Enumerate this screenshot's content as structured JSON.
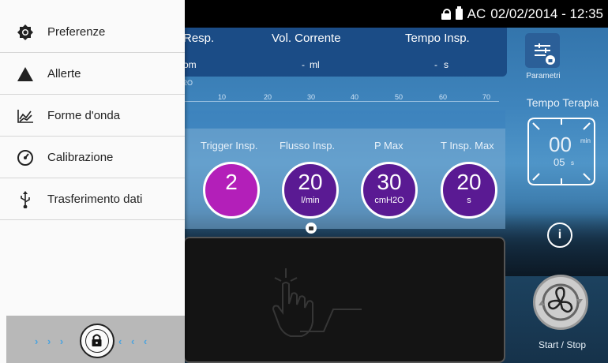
{
  "status_bar": {
    "mode": "AC",
    "datetime": "02/02/2014 - 12:35"
  },
  "measurements": {
    "headers": [
      "Resp.",
      "Vol. Corrente",
      "Tempo Insp."
    ],
    "values": [
      "om",
      "ml",
      "s"
    ],
    "dashes": [
      "-",
      "-"
    ]
  },
  "ruler": {
    "unit": "2O",
    "ticks": [
      "10",
      "20",
      "30",
      "40",
      "50",
      "60",
      "70"
    ]
  },
  "parameters": [
    {
      "label": "Trigger Insp.",
      "value": "2",
      "unit": "",
      "color": "#b31fb9"
    },
    {
      "label": "Flusso Insp.",
      "value": "20",
      "unit": "l/min",
      "color": "#5a1a93"
    },
    {
      "label": "P Max",
      "value": "30",
      "unit": "cmH2O",
      "color": "#5a1a93"
    },
    {
      "label": "T Insp. Max",
      "value": "20",
      "unit": "s",
      "color": "#5a1a93"
    }
  ],
  "right_panel": {
    "param_button_label": "Parametri",
    "therapy_label": "Tempo Terapia",
    "timer_main": "00",
    "timer_main_unit": "min",
    "timer_sub": "05",
    "timer_sub_unit": "s",
    "start_stop_label": "Start / Stop"
  },
  "drawer": {
    "items": [
      {
        "label": "Preferenze",
        "icon": "settings-icon"
      },
      {
        "label": "Allerte",
        "icon": "warning-triangle-icon"
      },
      {
        "label": "Forme d'onda",
        "icon": "waveform-icon"
      },
      {
        "label": "Calibrazione",
        "icon": "gauge-icon"
      },
      {
        "label": "Trasferimento dati",
        "icon": "usb-icon"
      }
    ],
    "unlock_left": "› › ›",
    "unlock_right": "‹ ‹ ‹"
  },
  "colors": {
    "drawer_bg": "#fafafa",
    "panel_blue": "#1b4c86",
    "magenta": "#b31fb9",
    "purple": "#5a1a93",
    "accent_arrows": "#4aa3df"
  }
}
